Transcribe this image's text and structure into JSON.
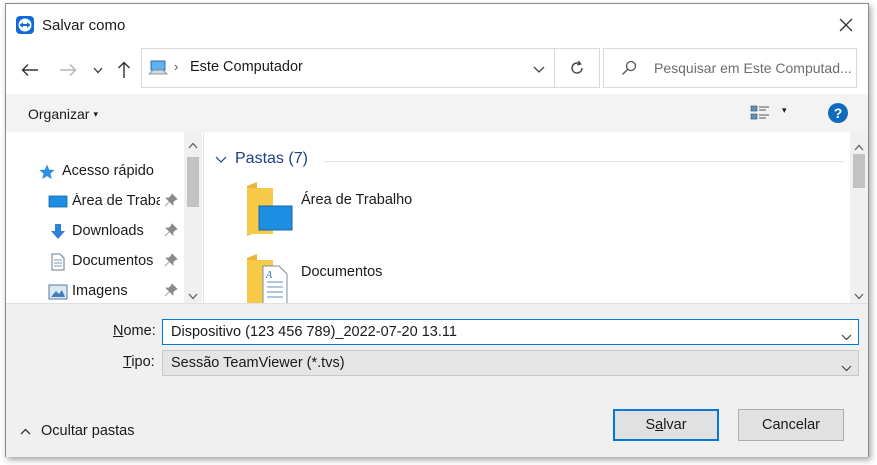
{
  "window": {
    "title": "Salvar como",
    "app_icon": "teamviewer-icon",
    "close_icon": "close-icon"
  },
  "navigation": {
    "back_icon": "arrow-left-icon",
    "forward_icon": "arrow-right-icon",
    "recent_icon": "chevron-down-icon",
    "up_icon": "arrow-up-icon"
  },
  "address": {
    "location": "Este Computador",
    "separator": "›",
    "refresh_icon": "refresh-icon"
  },
  "search": {
    "placeholder": "Pesquisar em Este Computad..."
  },
  "toolbar": {
    "organize_label": "Organizar",
    "organize_caret": "▾",
    "view_caret": "▾",
    "help_label": "?"
  },
  "sidebar": {
    "items": [
      {
        "label": "Acesso rápido",
        "icon": "star-icon",
        "pinned": false
      },
      {
        "label": "Área de Trabalho",
        "icon": "desktop-icon",
        "pinned": true
      },
      {
        "label": "Downloads",
        "icon": "download-icon",
        "pinned": true
      },
      {
        "label": "Documentos",
        "icon": "document-icon",
        "pinned": true
      },
      {
        "label": "Imagens",
        "icon": "image-icon",
        "pinned": true
      }
    ]
  },
  "content": {
    "group_title": "Pastas (7)",
    "folders": [
      {
        "label": "Área de Trabalho",
        "icon": "desktop-folder-icon"
      },
      {
        "label": "Documentos",
        "icon": "documents-folder-icon"
      }
    ]
  },
  "form": {
    "name_label_accel": "N",
    "name_label_rest": "ome:",
    "name_value": "Dispositivo (123 456 789)_2022-07-20 13.11",
    "type_label_accel": "T",
    "type_label_rest": "ipo:",
    "type_value": "Sessão TeamViewer (*.tvs)"
  },
  "footer": {
    "hide_folders_label": "Ocultar pastas",
    "save_label_pre": "S",
    "save_label_accel": "a",
    "save_label_post": "lvar",
    "cancel_label": "Cancelar"
  },
  "colors": {
    "accent": "#0078d7",
    "group_title": "#1e3f8a",
    "folder_yellow": "#f7c948",
    "bottom_bg": "#f0f0f0"
  }
}
